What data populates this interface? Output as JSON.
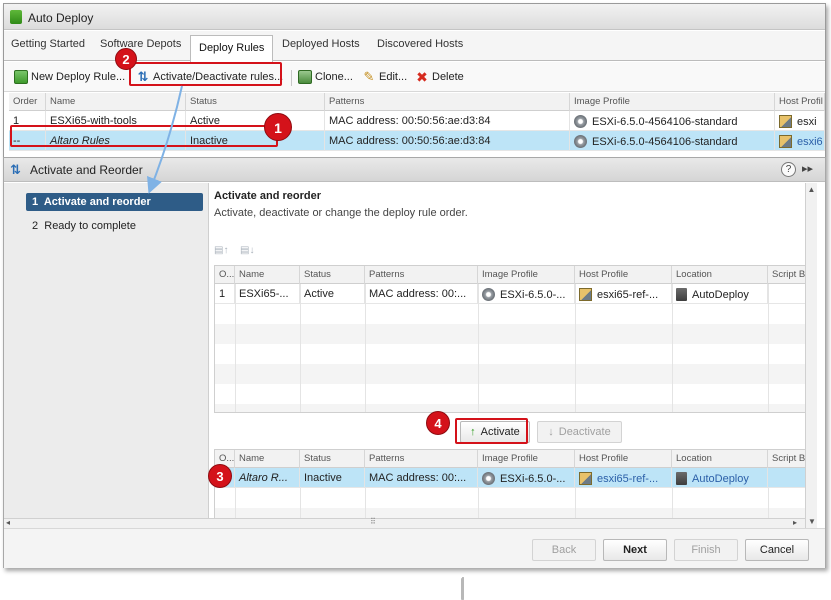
{
  "window": {
    "title": "Auto Deploy"
  },
  "tabs": [
    {
      "label": "Getting Started"
    },
    {
      "label": "Software Depots"
    },
    {
      "label": "Deploy Rules"
    },
    {
      "label": "Deployed Hosts"
    },
    {
      "label": "Discovered Hosts"
    }
  ],
  "toolbar": {
    "new_label": "New Deploy Rule...",
    "activate_label": "Activate/Deactivate rules...",
    "clone_label": "Clone...",
    "edit_label": "Edit...",
    "delete_label": "Delete"
  },
  "rules_grid": {
    "columns": [
      "Order",
      "Name",
      "Status",
      "Patterns",
      "Image Profile",
      "Host Profil"
    ],
    "rows": [
      {
        "order": "1",
        "name": "ESXi65-with-tools",
        "status": "Active",
        "pattern": "MAC address: 00:50:56:ae:d3:84",
        "image_profile": "ESXi-6.5.0-4564106-standard",
        "host_profile": "esxi"
      },
      {
        "order": "--",
        "name": "Altaro Rules",
        "status": "Inactive",
        "pattern": "MAC address: 00:50:56:ae:d3:84",
        "image_profile": "ESXi-6.5.0-4564106-standard",
        "host_profile": "esxi6"
      }
    ]
  },
  "dialog": {
    "title": "Activate and Reorder",
    "help": "?",
    "steps": [
      {
        "num": "1",
        "label": "Activate and reorder"
      },
      {
        "num": "2",
        "label": "Ready to complete"
      }
    ],
    "content_title": "Activate and reorder",
    "content_desc": "Activate, deactivate or change the deploy rule order.",
    "grid_columns": [
      "O...",
      "Name",
      "Status",
      "Patterns",
      "Image Profile",
      "Host Profile",
      "Location",
      "Script Bu"
    ],
    "active_rows": [
      {
        "order": "1",
        "name": "ESXi65-...",
        "status": "Active",
        "pattern": "MAC address: 00:...",
        "image_profile": "ESXi-6.5.0-...",
        "host_profile": "esxi65-ref-...",
        "location": "AutoDeploy"
      }
    ],
    "inactive_rows": [
      {
        "order": "",
        "name": "Altaro R...",
        "status": "Inactive",
        "pattern": "MAC address: 00:...",
        "image_profile": "ESXi-6.5.0-...",
        "host_profile": "esxi65-ref-...",
        "location": "AutoDeploy"
      }
    ],
    "activate_label": "Activate",
    "deactivate_label": "Deactivate",
    "buttons": {
      "back": "Back",
      "next": "Next",
      "finish": "Finish",
      "cancel": "Cancel"
    }
  },
  "annotations": [
    "1",
    "2",
    "3",
    "4"
  ],
  "colors": {
    "annotation_red": "#d4121a",
    "selection": "#bde4f7",
    "step_active": "#2e5c87",
    "link": "#2b5fa8"
  }
}
